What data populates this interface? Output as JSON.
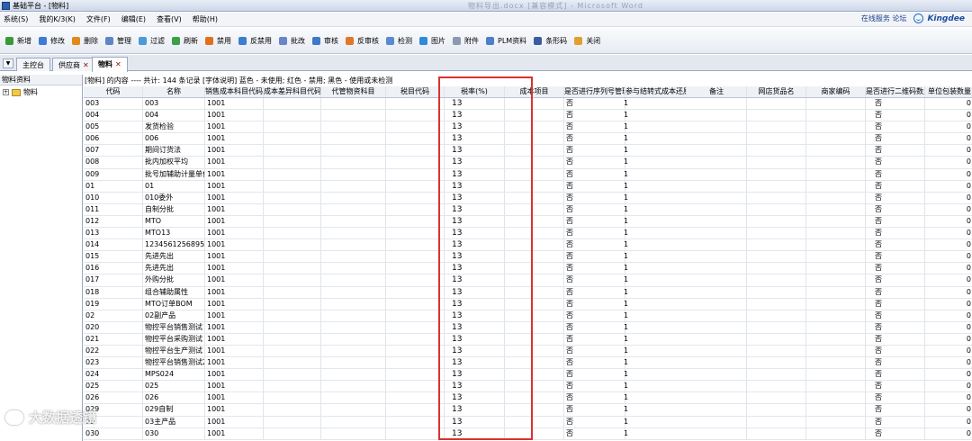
{
  "window": {
    "title": "基础平台 - [物料]",
    "center_text": "物料导出.docx [兼容模式] - Microsoft Word"
  },
  "menu": [
    "系统(S)",
    "我的K/3(K)",
    "文件(F)",
    "编辑(E)",
    "查看(V)",
    "帮助(H)"
  ],
  "menu_right": {
    "online": "在线服务  论坛",
    "brand": "Kingdee"
  },
  "toolbar": [
    {
      "label": "新增",
      "icon": "add-icon",
      "color": "#3a9a3a"
    },
    {
      "label": "修改",
      "icon": "edit-icon",
      "color": "#3d7bd6"
    },
    {
      "label": "删除",
      "icon": "delete-icon",
      "color": "#e08a1e"
    },
    {
      "label": "管理",
      "icon": "manage-icon",
      "color": "#5f86c4"
    },
    {
      "label": "过滤",
      "icon": "filter-icon",
      "color": "#4a9bd6"
    },
    {
      "label": "刷新",
      "icon": "refresh-icon",
      "color": "#3aa04a"
    },
    {
      "label": "禁用",
      "icon": "disable-icon",
      "color": "#e07020"
    },
    {
      "label": "反禁用",
      "icon": "undisable-icon",
      "color": "#3c7fd0"
    },
    {
      "label": "批改",
      "icon": "batch-edit-icon",
      "color": "#6a86c8"
    },
    {
      "label": "审核",
      "icon": "audit-icon",
      "color": "#3d79c8"
    },
    {
      "label": "反审核",
      "icon": "unaudit-icon",
      "color": "#e0782a"
    },
    {
      "label": "检测",
      "icon": "check-icon",
      "color": "#5a8ad0"
    },
    {
      "label": "图片",
      "icon": "image-icon",
      "color": "#2f8ad8"
    },
    {
      "label": "附件",
      "icon": "attachment-icon",
      "color": "#8a9ab0"
    },
    {
      "label": "PLM资料",
      "icon": "plm-icon",
      "color": "#4f7fc8"
    },
    {
      "label": "条形码",
      "icon": "barcode-icon",
      "color": "#3a5da0"
    },
    {
      "label": "关闭",
      "icon": "close-icon",
      "color": "#e0a030"
    }
  ],
  "tabs": [
    {
      "label": "主控台",
      "closable": false
    },
    {
      "label": "供应商",
      "closable": true
    },
    {
      "label": "物料",
      "closable": true,
      "active": true
    }
  ],
  "left_panel": {
    "header": "物料资料",
    "tree_root": "物料"
  },
  "info_text": "[物料] 的内容 ---- 共计: 144 条记录  [字体说明] 蓝色 - 未使用; 红色 - 禁用; 黑色 - 使用或未检测",
  "columns": [
    "代码",
    "名称",
    "销售成本科目代码",
    "成本差异科目代码",
    "代管物资科目",
    "税目代码",
    "税率(%)",
    "成本项目",
    "是否进行序列号管理",
    "参与结转式成本还原",
    "备注",
    "网店货品名",
    "商家编码",
    "是否进行二维码数量校验",
    "单位包装数量"
  ],
  "rows": [
    {
      "code": "003",
      "name": "003",
      "sales": "1001",
      "tax": "13",
      "serial": "否",
      "cost_roll": "1",
      "qr": "否",
      "pkg": "0"
    },
    {
      "code": "004",
      "name": "004",
      "sales": "1001",
      "tax": "13",
      "serial": "否",
      "cost_roll": "1",
      "qr": "否",
      "pkg": "0"
    },
    {
      "code": "005",
      "name": "发货检验",
      "sales": "1001",
      "tax": "13",
      "serial": "否",
      "cost_roll": "1",
      "qr": "否",
      "pkg": "0"
    },
    {
      "code": "006",
      "name": "006",
      "sales": "1001",
      "tax": "13",
      "serial": "否",
      "cost_roll": "1",
      "qr": "否",
      "pkg": "0"
    },
    {
      "code": "007",
      "name": "期间订货法",
      "sales": "1001",
      "tax": "13",
      "serial": "否",
      "cost_roll": "1",
      "qr": "否",
      "pkg": "0"
    },
    {
      "code": "008",
      "name": "批内加权平均",
      "sales": "1001",
      "tax": "13",
      "serial": "否",
      "cost_roll": "1",
      "qr": "否",
      "pkg": "0"
    },
    {
      "code": "009",
      "name": "批号加辅助计量单位",
      "sales": "1001",
      "tax": "13",
      "serial": "否",
      "cost_roll": "1",
      "qr": "否",
      "pkg": "0"
    },
    {
      "code": "01",
      "name": "01",
      "sales": "1001",
      "tax": "13",
      "serial": "否",
      "cost_roll": "1",
      "qr": "否",
      "pkg": "0"
    },
    {
      "code": "010",
      "name": "010委外",
      "sales": "1001",
      "tax": "13",
      "serial": "否",
      "cost_roll": "1",
      "qr": "否",
      "pkg": "0"
    },
    {
      "code": "011",
      "name": "自制分批",
      "sales": "1001",
      "tax": "13",
      "serial": "否",
      "cost_roll": "1",
      "qr": "否",
      "pkg": "0"
    },
    {
      "code": "012",
      "name": "MTO",
      "sales": "1001",
      "tax": "13",
      "serial": "否",
      "cost_roll": "1",
      "qr": "否",
      "pkg": "0"
    },
    {
      "code": "013",
      "name": "MTO13",
      "sales": "1001",
      "tax": "13",
      "serial": "否",
      "cost_roll": "1",
      "qr": "否",
      "pkg": "0"
    },
    {
      "code": "014",
      "name": "12345612568956889",
      "sales": "1001",
      "tax": "13",
      "serial": "否",
      "cost_roll": "1",
      "qr": "否",
      "pkg": "0"
    },
    {
      "code": "015",
      "name": "先进先出",
      "sales": "1001",
      "tax": "13",
      "serial": "否",
      "cost_roll": "1",
      "qr": "否",
      "pkg": "0"
    },
    {
      "code": "016",
      "name": "先进先出",
      "sales": "1001",
      "tax": "13",
      "serial": "否",
      "cost_roll": "1",
      "qr": "否",
      "pkg": "0"
    },
    {
      "code": "017",
      "name": "外购分批",
      "sales": "1001",
      "tax": "13",
      "serial": "否",
      "cost_roll": "1",
      "qr": "否",
      "pkg": "0"
    },
    {
      "code": "018",
      "name": "组合辅助属性",
      "sales": "1001",
      "tax": "13",
      "serial": "否",
      "cost_roll": "1",
      "qr": "否",
      "pkg": "0"
    },
    {
      "code": "019",
      "name": "MTO订单BOM",
      "sales": "1001",
      "tax": "13",
      "serial": "否",
      "cost_roll": "1",
      "qr": "否",
      "pkg": "0"
    },
    {
      "code": "02",
      "name": "02副产品",
      "sales": "1001",
      "tax": "13",
      "serial": "否",
      "cost_roll": "1",
      "qr": "否",
      "pkg": "0"
    },
    {
      "code": "020",
      "name": "物控平台销售测试",
      "sales": "1001",
      "tax": "13",
      "serial": "否",
      "cost_roll": "1",
      "qr": "否",
      "pkg": "0"
    },
    {
      "code": "021",
      "name": "物控平台采购测试",
      "sales": "1001",
      "tax": "13",
      "serial": "否",
      "cost_roll": "1",
      "qr": "否",
      "pkg": "0"
    },
    {
      "code": "022",
      "name": "物控平台生产测试",
      "sales": "1001",
      "tax": "13",
      "serial": "否",
      "cost_roll": "1",
      "qr": "否",
      "pkg": "0"
    },
    {
      "code": "023",
      "name": "物控平台销售测试2",
      "sales": "1001",
      "tax": "13",
      "serial": "否",
      "cost_roll": "1",
      "qr": "否",
      "pkg": "0"
    },
    {
      "code": "024",
      "name": "MPS024",
      "sales": "1001",
      "tax": "13",
      "serial": "否",
      "cost_roll": "1",
      "qr": "否",
      "pkg": "0"
    },
    {
      "code": "025",
      "name": "025",
      "sales": "1001",
      "tax": "13",
      "serial": "否",
      "cost_roll": "1",
      "qr": "否",
      "pkg": "0"
    },
    {
      "code": "026",
      "name": "026",
      "sales": "1001",
      "tax": "13",
      "serial": "否",
      "cost_roll": "1",
      "qr": "否",
      "pkg": "0"
    },
    {
      "code": "029",
      "name": "029自制",
      "sales": "1001",
      "tax": "13",
      "serial": "否",
      "cost_roll": "1",
      "qr": "否",
      "pkg": "0"
    },
    {
      "code": "03",
      "name": "03主产品",
      "sales": "1001",
      "tax": "13",
      "serial": "否",
      "cost_roll": "1",
      "qr": "否",
      "pkg": "0"
    },
    {
      "code": "030",
      "name": "030",
      "sales": "1001",
      "tax": "13",
      "serial": "否",
      "cost_roll": "1",
      "qr": "否",
      "pkg": "0"
    }
  ],
  "watermark": "大数据透镜",
  "colors": {
    "highlight_box": "#d9322f",
    "brand_blue": "#1a4d9e"
  }
}
